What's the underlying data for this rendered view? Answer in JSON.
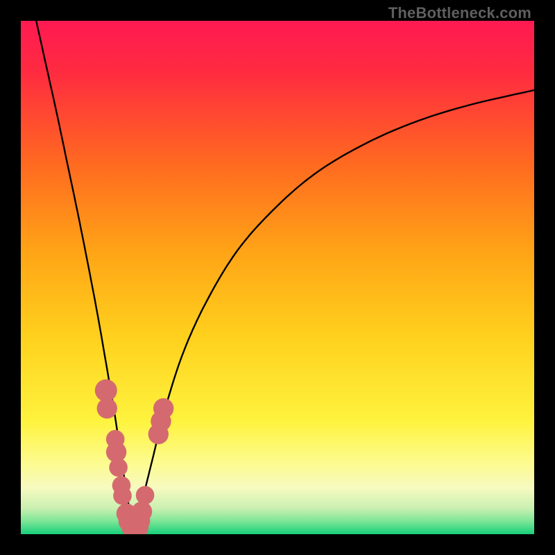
{
  "watermark": "TheBottleneck.com",
  "chart_data": {
    "type": "line",
    "title": "",
    "xlabel": "",
    "ylabel": "",
    "xlim": [
      0,
      100
    ],
    "ylim": [
      0,
      100
    ],
    "grid": false,
    "background_gradient": {
      "stops": [
        {
          "pos": 0.0,
          "color": "#ff1a52"
        },
        {
          "pos": 0.1,
          "color": "#ff2b40"
        },
        {
          "pos": 0.28,
          "color": "#ff6a20"
        },
        {
          "pos": 0.45,
          "color": "#ffa416"
        },
        {
          "pos": 0.62,
          "color": "#ffd21e"
        },
        {
          "pos": 0.78,
          "color": "#fef33e"
        },
        {
          "pos": 0.86,
          "color": "#fdfb8e"
        },
        {
          "pos": 0.91,
          "color": "#f6fac0"
        },
        {
          "pos": 0.95,
          "color": "#c9f0b1"
        },
        {
          "pos": 0.975,
          "color": "#7be596"
        },
        {
          "pos": 1.0,
          "color": "#17d07b"
        }
      ]
    },
    "series": [
      {
        "name": "bottleneck-curve-left",
        "stroke": "#000000",
        "x": [
          3.0,
          5.0,
          7.0,
          9.0,
          11.0,
          13.0,
          15.0,
          17.0,
          18.5,
          19.5,
          20.5,
          21.3,
          22.0
        ],
        "y": [
          100.0,
          91.0,
          82.0,
          72.5,
          63.0,
          53.0,
          42.5,
          31.0,
          22.0,
          15.0,
          9.0,
          4.0,
          1.0
        ]
      },
      {
        "name": "bottleneck-curve-right",
        "stroke": "#000000",
        "x": [
          22.0,
          23.5,
          25.5,
          28.0,
          31.5,
          36.0,
          42.0,
          49.0,
          57.0,
          66.0,
          76.0,
          87.0,
          100.0
        ],
        "y": [
          1.0,
          6.0,
          14.0,
          24.0,
          35.0,
          45.0,
          55.0,
          63.0,
          70.0,
          75.5,
          80.0,
          83.5,
          86.5
        ]
      }
    ],
    "markers": {
      "name": "highlight-points",
      "fill": "#d46a6f",
      "points": [
        {
          "x": 16.6,
          "y": 28.0,
          "r": 2.4
        },
        {
          "x": 16.8,
          "y": 24.5,
          "r": 2.2
        },
        {
          "x": 18.4,
          "y": 18.5,
          "r": 2.0
        },
        {
          "x": 18.6,
          "y": 16.0,
          "r": 2.2
        },
        {
          "x": 19.0,
          "y": 13.0,
          "r": 2.0
        },
        {
          "x": 19.6,
          "y": 9.5,
          "r": 2.0
        },
        {
          "x": 19.8,
          "y": 7.5,
          "r": 2.0
        },
        {
          "x": 20.6,
          "y": 4.0,
          "r": 2.2
        },
        {
          "x": 21.0,
          "y": 2.5,
          "r": 2.2
        },
        {
          "x": 21.8,
          "y": 1.3,
          "r": 2.4
        },
        {
          "x": 22.1,
          "y": 1.0,
          "r": 2.4
        },
        {
          "x": 22.7,
          "y": 1.3,
          "r": 2.4
        },
        {
          "x": 23.2,
          "y": 2.6,
          "r": 2.2
        },
        {
          "x": 23.6,
          "y": 4.4,
          "r": 2.2
        },
        {
          "x": 24.2,
          "y": 7.6,
          "r": 2.0
        },
        {
          "x": 26.8,
          "y": 19.5,
          "r": 2.2
        },
        {
          "x": 27.3,
          "y": 22.0,
          "r": 2.2
        },
        {
          "x": 27.8,
          "y": 24.5,
          "r": 2.2
        }
      ]
    }
  }
}
